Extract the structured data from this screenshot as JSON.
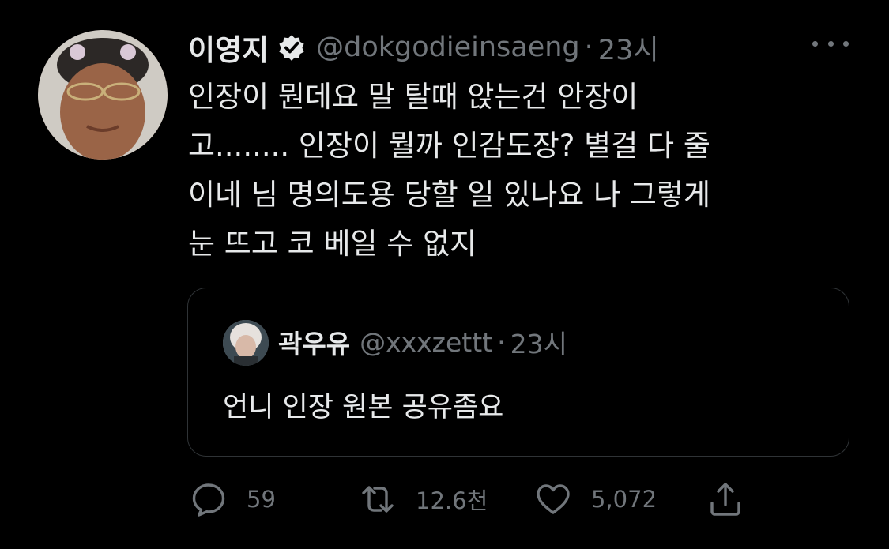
{
  "tweet": {
    "display_name": "이영지",
    "handle": "@dokgodieinsaeng",
    "separator": "·",
    "time": "23시",
    "text_lines": [
      "인장이 뭔데요 말 탈때 앉는건 안장이",
      "고........ 인장이 뭘까 인감도장? 별걸 다 줄",
      "이네 님 명의도용 당할 일 있나요 나 그렇게",
      "눈 뜨고 코 베일 수 없지"
    ]
  },
  "quote": {
    "display_name": "곽우유",
    "handle": "@xxxzettt",
    "separator": "·",
    "time": "23시",
    "text": "언니 인장 원본 공유좀요"
  },
  "actions": {
    "reply_count": "59",
    "retweet_count": "12.6천",
    "like_count": "5,072"
  },
  "icons": {
    "verified": "verified-badge-icon",
    "more": "more-dots-icon",
    "reply": "reply-icon",
    "retweet": "retweet-icon",
    "like": "heart-icon",
    "share": "share-icon"
  },
  "colors": {
    "background": "#000000",
    "text_primary": "#e7e9ea",
    "text_secondary": "#71767b",
    "border": "#2f3336"
  }
}
